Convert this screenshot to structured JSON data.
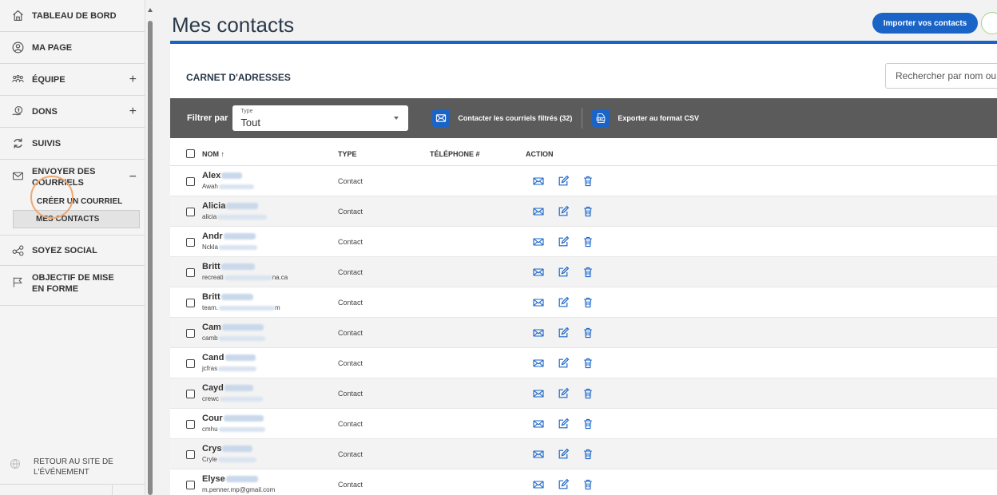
{
  "sidebar": {
    "items": [
      {
        "label": "TABLEAU DE BORD",
        "icon": "home-icon"
      },
      {
        "label": "MA PAGE",
        "icon": "user-circle-icon"
      },
      {
        "label": "ÉQUIPE",
        "icon": "team-icon",
        "expand": "+"
      },
      {
        "label": "DONS",
        "icon": "donation-icon",
        "expand": "+"
      },
      {
        "label": "SUIVIS",
        "icon": "refresh-icon"
      },
      {
        "label": "ENVOYER DES COURRIELS",
        "icon": "mail-icon",
        "expand": "−"
      },
      {
        "label": "SOYEZ SOCIAL",
        "icon": "share-icon"
      },
      {
        "label": "OBJECTIF DE MISE EN FORME",
        "icon": "flag-icon"
      }
    ],
    "submenu": [
      "CRÉER UN COURRIEL",
      "MES CONTACTS"
    ],
    "back_link": "RETOUR AU SITE DE L'ÉVÉNEMENT"
  },
  "header": {
    "title": "Mes contacts",
    "import_button": "Importer vos contacts"
  },
  "card": {
    "title": "CARNET D'ADRESSES",
    "search_placeholder": "Rechercher par nom ou"
  },
  "filter_bar": {
    "label": "Filtrer par",
    "select_label": "Type",
    "select_value": "Tout",
    "contact_filtered": "Contacter les courriels filtrés (32)",
    "export_csv": "Exporter au format CSV"
  },
  "table": {
    "headers": {
      "name": "NOM ↑",
      "type": "TYPE",
      "phone": "TÉLÉPHONE #",
      "action": "ACTION"
    },
    "rows": [
      {
        "name": "Alex",
        "email": "Awah",
        "type": "Contact"
      },
      {
        "name": "Alicia",
        "email": "alicia",
        "type": "Contact"
      },
      {
        "name": "Andr",
        "email": "Nckla",
        "type": "Contact"
      },
      {
        "name": "Britt",
        "email": "recreati",
        "email_tail": "na.ca",
        "type": "Contact"
      },
      {
        "name": "Britt",
        "email": "team.",
        "email_tail": "m",
        "type": "Contact"
      },
      {
        "name": "Cam",
        "email": "camb",
        "type": "Contact"
      },
      {
        "name": "Cand",
        "email": "jcfras",
        "type": "Contact"
      },
      {
        "name": "Cayd",
        "email": "crewc",
        "type": "Contact"
      },
      {
        "name": "Cour",
        "email": "cmhu",
        "type": "Contact"
      },
      {
        "name": "Crys",
        "email": "Cryle",
        "type": "Contact"
      },
      {
        "name": "Elyse",
        "email": "m.penner.mp@gmail.com",
        "type": "Contact"
      }
    ]
  },
  "colors": {
    "accent": "#1a64c8",
    "filter_bar": "#5b5b5b",
    "highlight": "#f0a870"
  }
}
